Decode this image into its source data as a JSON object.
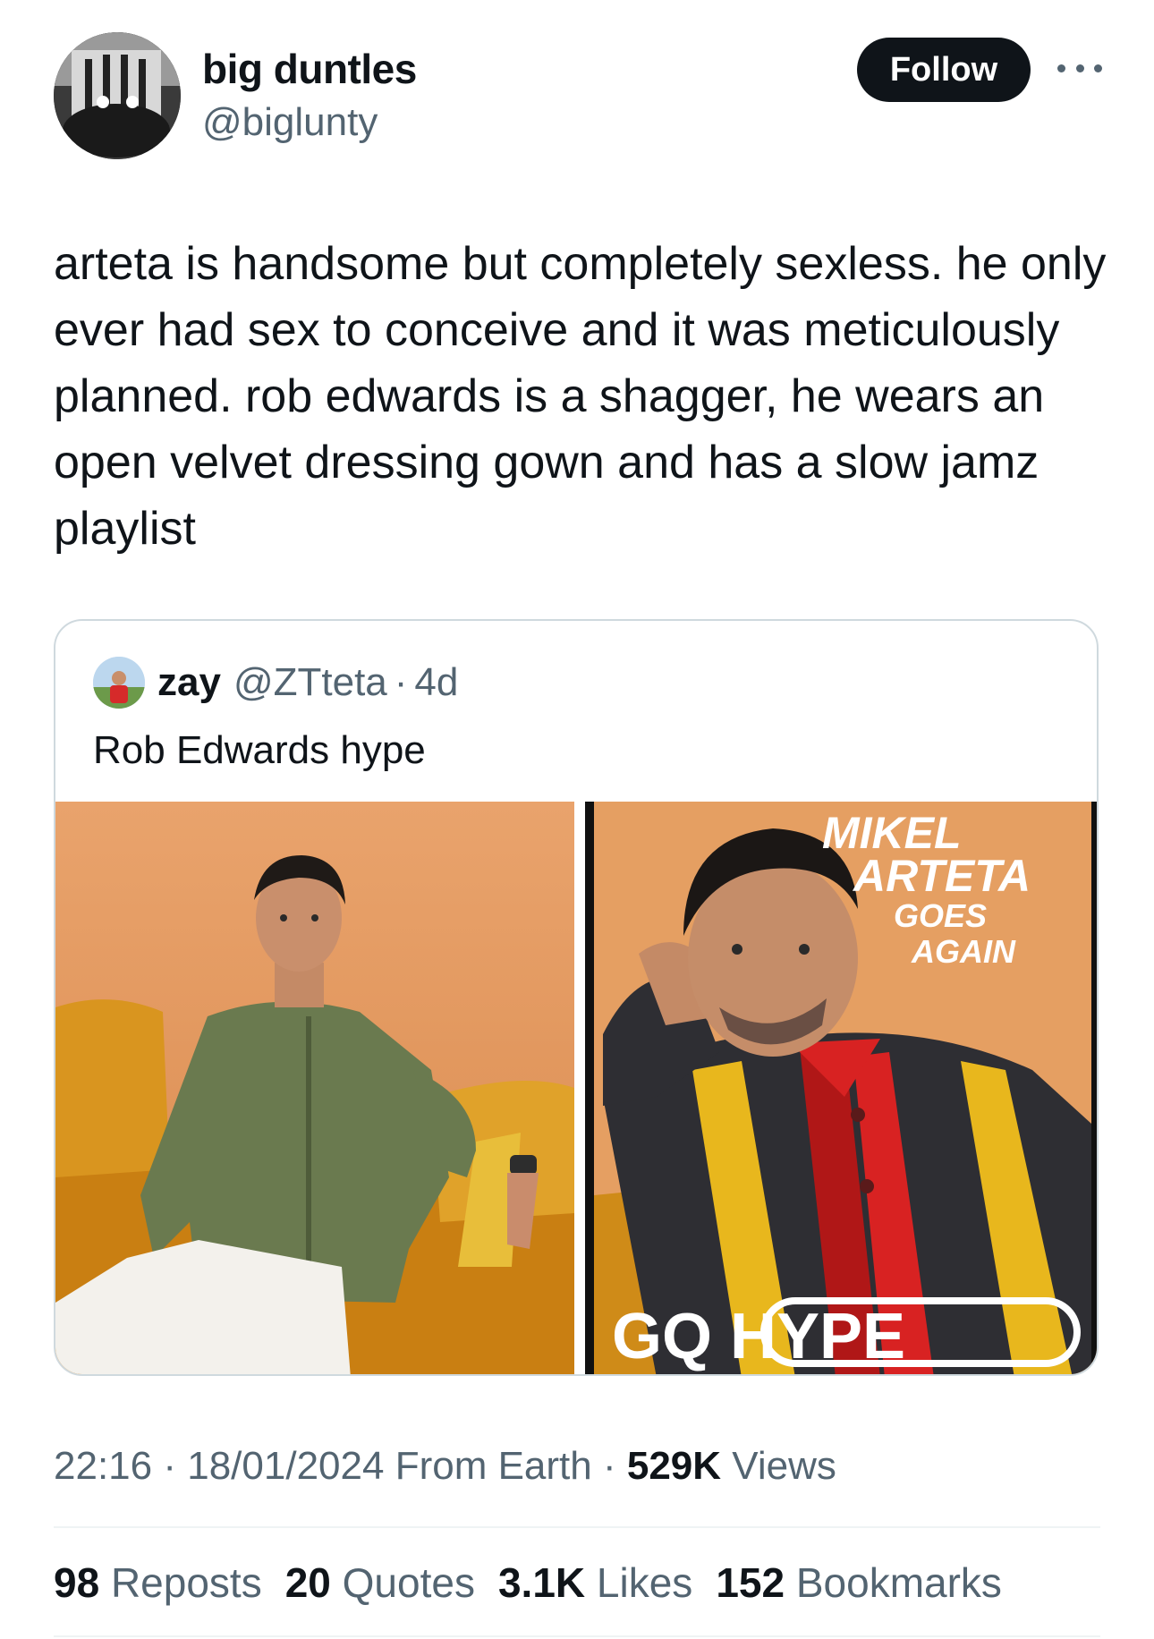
{
  "author": {
    "display_name": "big duntles",
    "handle": "@biglunty",
    "avatar_icon": "avatar-photo"
  },
  "follow_label": "Follow",
  "more_icon": "more-horizontal-icon",
  "tweet_text": "arteta is handsome but completely sexless. he only ever had sex to conceive and it was meticulously planned. rob edwards is a shagger, he wears an open velvet dressing gown and has a slow jamz playlist",
  "quoted": {
    "display_name": "zay",
    "handle": "@ZTteta",
    "separator": "·",
    "time": "4d",
    "text": "Rob Edwards hype",
    "photos": [
      {
        "icon": "man-green-shirt-orange-sofa-photo"
      },
      {
        "icon": "gq-hype-cover-photo",
        "cover_lines": [
          "MIKEL",
          "ARTETA",
          "GOES",
          "AGAIN"
        ],
        "logo_text": "GQ HYPE"
      }
    ]
  },
  "meta": {
    "time": "22:16",
    "date": "18/01/2024",
    "source": "From Earth",
    "views_count": "529K",
    "views_label": "Views",
    "separator": "·"
  },
  "stats": [
    {
      "count": "98",
      "label": "Reposts"
    },
    {
      "count": "20",
      "label": "Quotes"
    },
    {
      "count": "3.1K",
      "label": "Likes"
    },
    {
      "count": "152",
      "label": "Bookmarks"
    }
  ],
  "colors": {
    "text_primary": "#0f1419",
    "text_secondary": "#536471",
    "border": "#cfd9de",
    "follow_bg": "#0f1419"
  }
}
